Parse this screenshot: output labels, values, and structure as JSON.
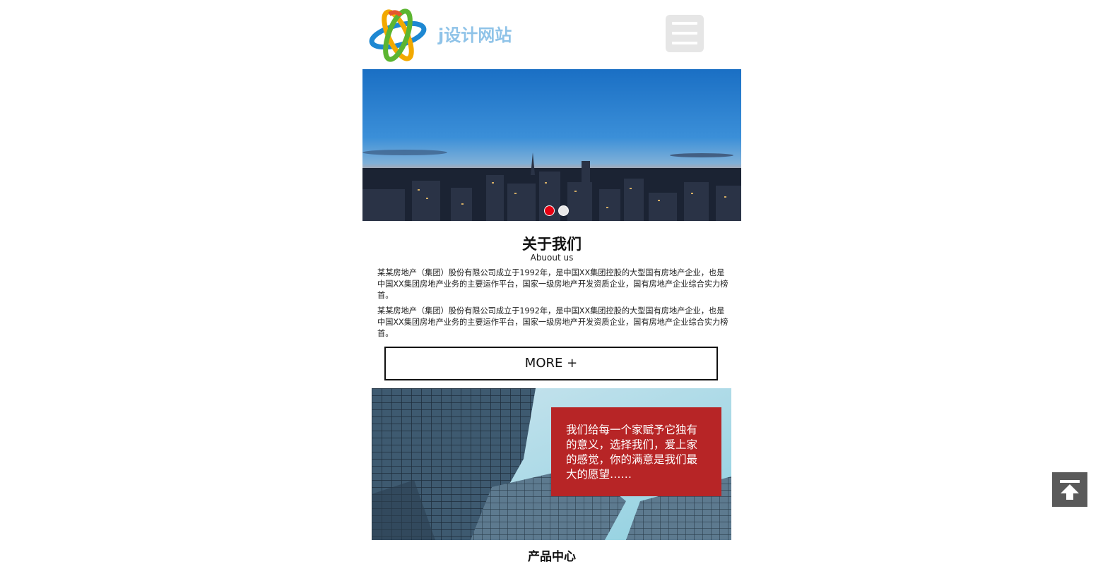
{
  "header": {
    "logo_text": "j设计网站",
    "logo_icon": "star-orbit-logo",
    "menu_icon": "hamburger-menu-icon"
  },
  "banner": {
    "image": "city-skyline-dusk",
    "slides": 2,
    "active_slide": 1,
    "active_dot_color": "#e60012"
  },
  "about": {
    "title": "关于我们",
    "subtitle": "Abuout us",
    "paragraphs": [
      "某某房地产（集团）股份有限公司成立于1992年，是中国XX集团控股的大型国有房地产企业，也是中国XX集团房地产业务的主要运作平台，国家一级房地产开发资质企业，国有房地产企业综合实力榜首。",
      "某某房地产（集团）股份有限公司成立于1992年，是中国XX集团控股的大型国有房地产企业，也是中国XX集团房地产业务的主要运作平台，国家一级房地产开发资质企业，国有房地产企业综合实力榜首。"
    ],
    "more_label": "MORE +"
  },
  "promo": {
    "image": "glass-skyscrapers",
    "text": "我们给每一个家赋予它独有的意义，选择我们，爱上家的感觉，你的满意是我们最大的愿望……",
    "card_color": "#b72526"
  },
  "next_section": {
    "title": "产品中心"
  },
  "back_to_top": {
    "icon": "arrow-up-to-line-icon"
  }
}
